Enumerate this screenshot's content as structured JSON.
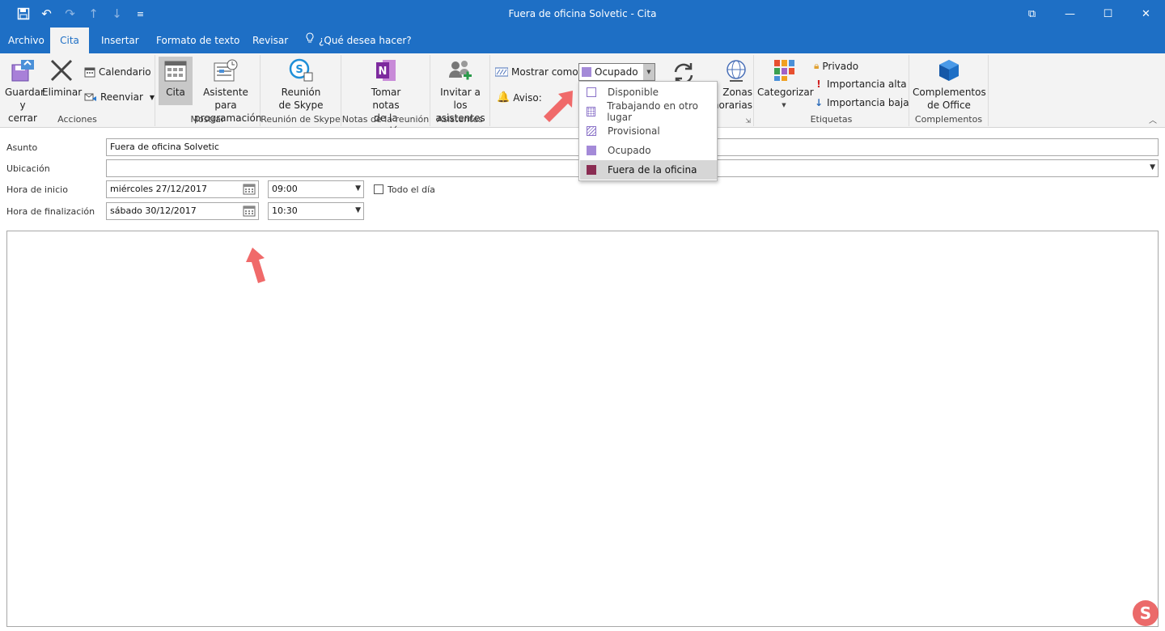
{
  "window": {
    "title": "Fuera de oficina Solvetic  -  Cita",
    "controls": {
      "restore": "⧉",
      "minimize": "—",
      "maximize": "☐",
      "close": "✕"
    }
  },
  "qat_icons": [
    "save-icon",
    "undo-icon",
    "redo-icon",
    "up-arrow-icon",
    "down-arrow-icon",
    "customize-icon"
  ],
  "tabs": [
    {
      "label": "Archivo",
      "active": false
    },
    {
      "label": "Cita",
      "active": true
    },
    {
      "label": "Insertar",
      "active": false
    },
    {
      "label": "Formato de texto",
      "active": false
    },
    {
      "label": "Revisar",
      "active": false
    },
    {
      "label": "¿Qué desea hacer?",
      "active": false
    }
  ],
  "ribbon": {
    "acciones": {
      "label": "Acciones",
      "save_close": "Guardar\ny cerrar",
      "delete": "Eliminar",
      "calendar": "Calendario",
      "forward": "Reenviar"
    },
    "mostrar": {
      "label": "Mostrar",
      "appointment": "Cita",
      "scheduling": "Asistente para\nprogramación"
    },
    "skype": {
      "label": "Reunión de Skype",
      "button": "Reunión\nde Skype"
    },
    "notes": {
      "label": "Notas de la reunión",
      "button": "Tomar notas\nde la reunión"
    },
    "attendees": {
      "label": "Asistentes",
      "button": "Invitar a los\nasistentes"
    },
    "options": {
      "show_as_label": "Mostrar como:",
      "show_as_value": "Ocupado",
      "reminder_label": "Aviso:",
      "timezones": "Zonas\nhorarias"
    },
    "tags": {
      "label": "Etiquetas",
      "categorize": "Categorizar",
      "private": "Privado",
      "high": "Importancia alta",
      "low": "Importancia baja"
    },
    "addins": {
      "label": "Complementos",
      "button": "Complementos\nde Office"
    }
  },
  "dropdown_options": [
    {
      "label": "Disponible",
      "color": "#ffffff",
      "selected": false
    },
    {
      "label": "Trabajando en otro lugar",
      "color": "#ffffff",
      "selected": false
    },
    {
      "label": "Provisional",
      "color": "#ffffff",
      "selected": false
    },
    {
      "label": "Ocupado",
      "color": "#a48ad8",
      "selected": false
    },
    {
      "label": "Fuera de la oficina",
      "color": "#8a2c52",
      "selected": true
    }
  ],
  "form": {
    "subject_label": "Asunto",
    "subject_value": "Fuera de oficina Solvetic",
    "location_label": "Ubicación",
    "location_value": "",
    "start_label": "Hora de inicio",
    "start_date": "miércoles 27/12/2017",
    "start_time": "09:00",
    "all_day_label": "Todo el día",
    "end_label": "Hora de finalización",
    "end_date": "sábado 30/12/2017",
    "end_time": "10:30"
  },
  "colors": {
    "brand": "#1e6fc5",
    "annotation_arrow": "#f06a6a"
  }
}
